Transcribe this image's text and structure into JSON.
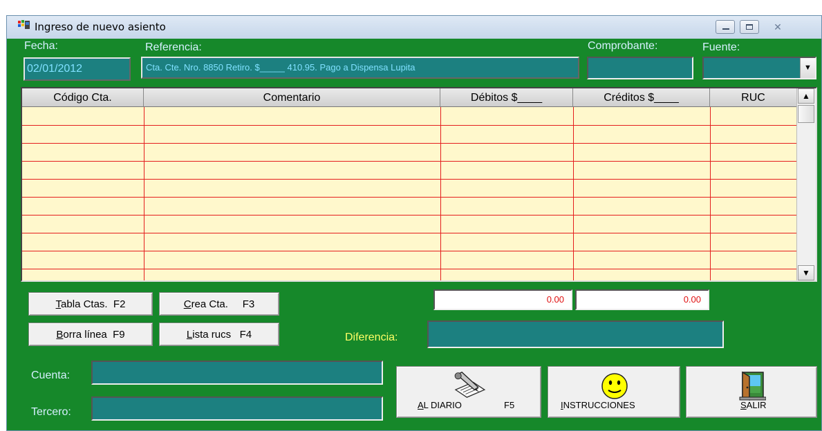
{
  "window": {
    "title": "Ingreso de nuevo asiento"
  },
  "labels": {
    "fecha": "Fecha:",
    "referencia": "Referencia:",
    "comprobante": "Comprobante:",
    "fuente": "Fuente:",
    "diferencia": "Diferencia:",
    "cuenta": "Cuenta:",
    "tercero": "Tercero:"
  },
  "fields": {
    "fecha": "02/01/2012",
    "referencia": "Cta. Cte. Nro. 8850  Retiro. $_____  410.95. Pago  a Dispensa Lupita",
    "comprobante": "",
    "fuente": "",
    "cuenta": "",
    "tercero": "",
    "diferencia": ""
  },
  "grid": {
    "columns": [
      "Código Cta.",
      "Comentario",
      "Débitos $____",
      "Créditos $____",
      "RUC"
    ]
  },
  "totals": {
    "debitos": "0.00",
    "creditos": "0.00"
  },
  "buttons": {
    "tabla_ctas": "Tabla Ctas.  F2",
    "crea_cta": "Crea Cta.     F3",
    "borra_linea": "Borra línea  F9",
    "lista_rucs": "Lista rucs   F4",
    "al_diario": "AL DIARIO",
    "al_diario_key": "F5",
    "instrucciones": "INSTRUCCIONES",
    "salir": "SALIR"
  },
  "icons": {
    "window": "windows-flag-icon",
    "al_diario": "pen-writing-icon",
    "instrucciones": "smiley-face-icon",
    "salir": "exit-door-icon"
  }
}
